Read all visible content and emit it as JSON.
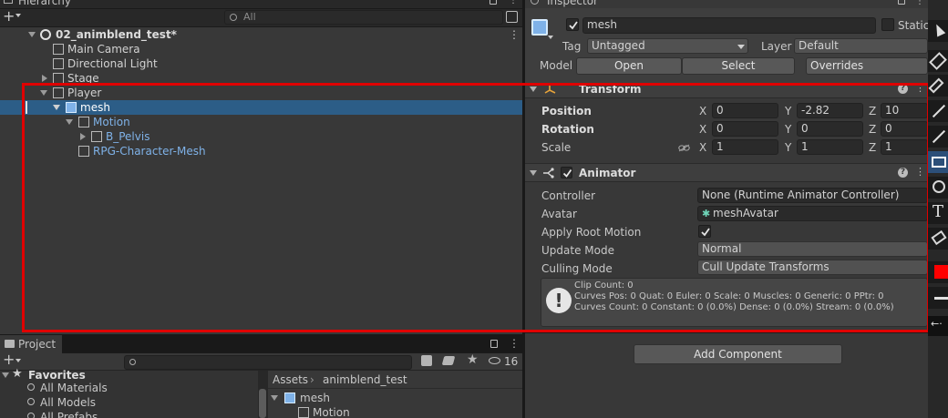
{
  "hierarchy": {
    "tab_label": "Hierarchy",
    "add_label": "+",
    "search_placeholder": "All",
    "scene_name": "02_animblend_test*",
    "items": {
      "main_camera": "Main Camera",
      "directional_light": "Directional Light",
      "stage": "Stage",
      "player": "Player",
      "mesh": "mesh",
      "motion": "Motion",
      "b_pelvis": "B_Pelvis",
      "rpg_mesh": "RPG-Character-Mesh"
    }
  },
  "inspector": {
    "tab_label": "Inspector",
    "object_name": "mesh",
    "active": true,
    "static_label": "Static",
    "tag_label": "Tag",
    "tag_value": "Untagged",
    "layer_label": "Layer",
    "layer_value": "Default",
    "model_label": "Model",
    "open_label": "Open",
    "select_label": "Select",
    "overrides_label": "Overrides",
    "transform": {
      "title": "Transform",
      "position_label": "Position",
      "rotation_label": "Rotation",
      "scale_label": "Scale",
      "x_label": "X",
      "y_label": "Y",
      "z_label": "Z",
      "position": {
        "x": "0",
        "y": "-2.82",
        "z": "10"
      },
      "rotation": {
        "x": "0",
        "y": "0",
        "z": "0"
      },
      "scale": {
        "x": "1",
        "y": "1",
        "z": "1"
      }
    },
    "animator": {
      "title": "Animator",
      "enabled": true,
      "controller_label": "Controller",
      "controller_value": "None (Runtime Animator Controller)",
      "avatar_label": "Avatar",
      "avatar_value": "meshAvatar",
      "apply_root_motion_label": "Apply Root Motion",
      "apply_root_motion": true,
      "update_mode_label": "Update Mode",
      "update_mode_value": "Normal",
      "culling_mode_label": "Culling Mode",
      "culling_mode_value": "Cull Update Transforms",
      "info_line1": "Clip Count: 0",
      "info_line2": "Curves Pos: 0 Quat: 0 Euler: 0 Scale: 0 Muscles: 0 Generic: 0 PPtr: 0",
      "info_line3": "Curves Count: 0 Constant: 0 (0.0%) Dense: 0 (0.0%) Stream: 0 (0.0%)"
    },
    "add_component_label": "Add Component"
  },
  "project": {
    "tab_label": "Project",
    "add_label": "+",
    "hidden_count": "16",
    "favorites_label": "Favorites",
    "favorites": [
      "All Materials",
      "All Models",
      "All Prefabs"
    ],
    "breadcrumb_root": "Assets",
    "breadcrumb_folder": "animblend_test",
    "assets": [
      "mesh",
      "Motion"
    ]
  },
  "colors": {
    "highlight_box": "#e00000",
    "selection": "#2c5d87",
    "prefab_blue": "#7fb2e8",
    "red_swatch": "#ff0000"
  }
}
